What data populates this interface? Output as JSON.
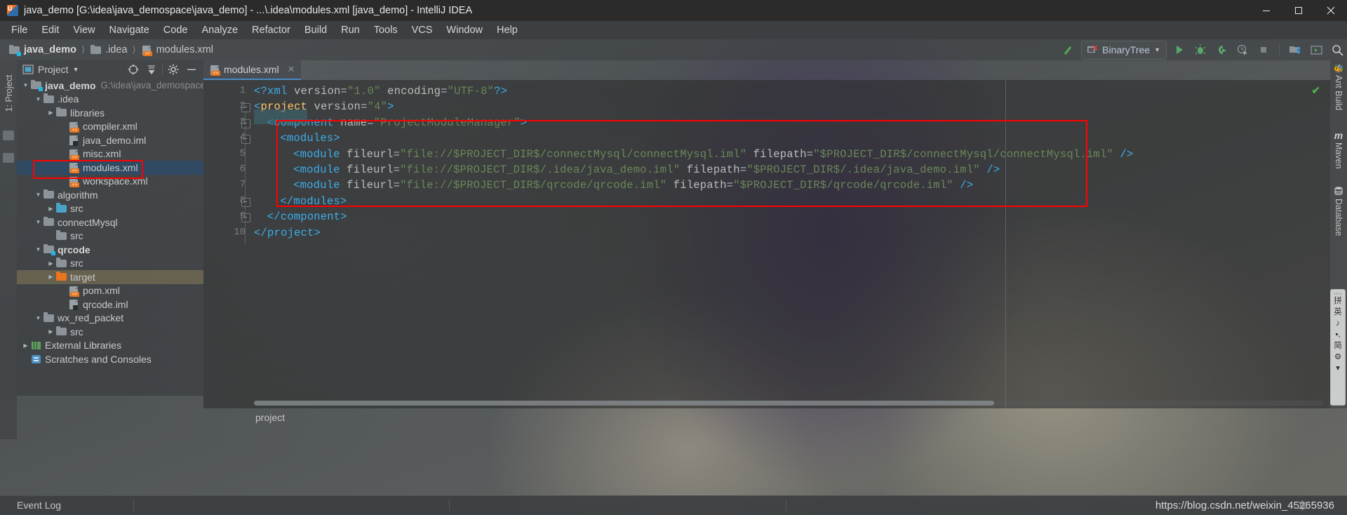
{
  "window": {
    "title": "java_demo [G:\\idea\\java_demospace\\java_demo] - ...\\.idea\\modules.xml [java_demo] - IntelliJ IDEA",
    "app_icon": "intellij-idea-icon",
    "controls": {
      "minimize": "minimize-icon",
      "maximize": "maximize-icon",
      "close": "close-icon"
    }
  },
  "menubar": {
    "items": [
      "File",
      "Edit",
      "View",
      "Navigate",
      "Code",
      "Analyze",
      "Refactor",
      "Build",
      "Run",
      "Tools",
      "VCS",
      "Window",
      "Help"
    ]
  },
  "navbar": {
    "breadcrumb": [
      "java_demo",
      ".idea",
      "modules.xml"
    ],
    "run_config": "BinaryTree",
    "buttons": [
      "run-icon",
      "debug-icon",
      "run-with-coverage-icon",
      "profiler-icon",
      "stop-icon",
      "project-structure-icon",
      "terminal-icon",
      "search-everywhere-icon"
    ],
    "build_icon": "make-project-icon"
  },
  "left_strip": {
    "label": "1: Project"
  },
  "right_strip": {
    "items": [
      "Ant Build",
      "Maven",
      "Database"
    ]
  },
  "project_tool_window": {
    "title": "Project",
    "header_buttons": [
      "scroll-from-source-icon",
      "collapse-all-icon",
      "settings-gear-icon",
      "hide-icon"
    ],
    "tree": [
      {
        "depth": 0,
        "arrow": "down",
        "icon": "module-folder-icon",
        "label": "java_demo",
        "bold": true,
        "path": "G:\\idea\\java_demospace\\j",
        "state": "normal"
      },
      {
        "depth": 1,
        "arrow": "down",
        "icon": "folder-icon",
        "label": ".idea",
        "bold": false,
        "path": "",
        "state": "normal"
      },
      {
        "depth": 2,
        "arrow": "right",
        "icon": "folder-icon",
        "label": "libraries",
        "bold": false,
        "path": "",
        "state": "normal"
      },
      {
        "depth": 3,
        "arrow": "none",
        "icon": "xml-file-icon",
        "label": "compiler.xml",
        "bold": false,
        "path": "",
        "state": "normal"
      },
      {
        "depth": 3,
        "arrow": "none",
        "icon": "iml-file-icon",
        "label": "java_demo.iml",
        "bold": false,
        "path": "",
        "state": "normal"
      },
      {
        "depth": 3,
        "arrow": "none",
        "icon": "xml-file-icon",
        "label": "misc.xml",
        "bold": false,
        "path": "",
        "state": "normal"
      },
      {
        "depth": 3,
        "arrow": "none",
        "icon": "xml-file-icon",
        "label": "modules.xml",
        "bold": false,
        "path": "",
        "state": "selected"
      },
      {
        "depth": 3,
        "arrow": "none",
        "icon": "xml-file-icon",
        "label": "workspace.xml",
        "bold": false,
        "path": "",
        "state": "normal"
      },
      {
        "depth": 1,
        "arrow": "down",
        "icon": "folder-icon",
        "label": "algorithm",
        "bold": false,
        "path": "",
        "state": "normal"
      },
      {
        "depth": 2,
        "arrow": "right",
        "icon": "source-folder-icon",
        "label": "src",
        "bold": false,
        "path": "",
        "state": "normal"
      },
      {
        "depth": 1,
        "arrow": "down",
        "icon": "folder-icon",
        "label": "connectMysql",
        "bold": false,
        "path": "",
        "state": "normal"
      },
      {
        "depth": 2,
        "arrow": "none",
        "icon": "folder-icon",
        "label": "src",
        "bold": false,
        "path": "",
        "state": "normal"
      },
      {
        "depth": 1,
        "arrow": "down",
        "icon": "module-folder-icon",
        "label": "qrcode",
        "bold": true,
        "path": "",
        "state": "normal"
      },
      {
        "depth": 2,
        "arrow": "right",
        "icon": "folder-icon",
        "label": "src",
        "bold": false,
        "path": "",
        "state": "normal"
      },
      {
        "depth": 2,
        "arrow": "right",
        "icon": "excluded-folder-icon",
        "label": "target",
        "bold": false,
        "path": "",
        "state": "highlighted"
      },
      {
        "depth": 3,
        "arrow": "none",
        "icon": "xml-file-icon",
        "label": "pom.xml",
        "bold": false,
        "path": "",
        "state": "normal"
      },
      {
        "depth": 3,
        "arrow": "none",
        "icon": "iml-file-icon",
        "label": "qrcode.iml",
        "bold": false,
        "path": "",
        "state": "normal"
      },
      {
        "depth": 1,
        "arrow": "down",
        "icon": "folder-icon",
        "label": "wx_red_packet",
        "bold": false,
        "path": "",
        "state": "normal"
      },
      {
        "depth": 2,
        "arrow": "right",
        "icon": "folder-icon",
        "label": "src",
        "bold": false,
        "path": "",
        "state": "normal"
      },
      {
        "depth": 0,
        "arrow": "right",
        "icon": "external-libraries-icon",
        "label": "External Libraries",
        "bold": false,
        "path": "",
        "state": "normal"
      },
      {
        "depth": 0,
        "arrow": "none",
        "icon": "scratches-icon",
        "label": "Scratches and Consoles",
        "bold": false,
        "path": "",
        "state": "normal"
      }
    ]
  },
  "editor": {
    "tab": {
      "label": "modules.xml",
      "icon": "xml-file-icon",
      "close": "close-tab-icon"
    },
    "line_numbers": [
      "1",
      "2",
      "3",
      "4",
      "5",
      "6",
      "7",
      "8",
      "9",
      "10"
    ],
    "inspection_status": "ok-check-icon",
    "breadcrumb": "project",
    "code": [
      {
        "n": 1,
        "indent": 0,
        "tokens": [
          {
            "t": "<?xml ",
            "c": "k-tag"
          },
          {
            "t": "version",
            "c": "k-attr"
          },
          {
            "t": "=",
            "c": "k-plain"
          },
          {
            "t": "\"1.0\"",
            "c": "k-str"
          },
          {
            "t": " encoding",
            "c": "k-attr"
          },
          {
            "t": "=",
            "c": "k-plain"
          },
          {
            "t": "\"UTF-8\"",
            "c": "k-str"
          },
          {
            "t": "?>",
            "c": "k-tag"
          }
        ]
      },
      {
        "n": 2,
        "indent": 0,
        "tokens": [
          {
            "t": "<",
            "c": "k-tag"
          },
          {
            "t": "project",
            "c": "k-name"
          },
          {
            "t": " version",
            "c": "k-attr"
          },
          {
            "t": "=",
            "c": "k-plain"
          },
          {
            "t": "\"4\"",
            "c": "k-str"
          },
          {
            "t": ">",
            "c": "k-tag"
          }
        ]
      },
      {
        "n": 3,
        "indent": 1,
        "tokens": [
          {
            "t": "<",
            "c": "k-tag"
          },
          {
            "t": "component",
            "c": "k-tag"
          },
          {
            "t": " name",
            "c": "k-attr"
          },
          {
            "t": "=",
            "c": "k-plain"
          },
          {
            "t": "\"ProjectModuleManager\"",
            "c": "k-str"
          },
          {
            "t": ">",
            "c": "k-tag"
          }
        ]
      },
      {
        "n": 4,
        "indent": 2,
        "tokens": [
          {
            "t": "<modules>",
            "c": "k-tag"
          }
        ]
      },
      {
        "n": 5,
        "indent": 3,
        "tokens": [
          {
            "t": "<module",
            "c": "k-tag"
          },
          {
            "t": " fileurl",
            "c": "k-attr"
          },
          {
            "t": "=",
            "c": "k-plain"
          },
          {
            "t": "\"file://$PROJECT_DIR$/connectMysql/connectMysql.iml\"",
            "c": "k-str"
          },
          {
            "t": " filepath",
            "c": "k-attr"
          },
          {
            "t": "=",
            "c": "k-plain"
          },
          {
            "t": "\"$PROJECT_DIR$/connectMysql/connectMysql.iml\"",
            "c": "k-str"
          },
          {
            "t": " />",
            "c": "k-tag"
          }
        ]
      },
      {
        "n": 6,
        "indent": 3,
        "tokens": [
          {
            "t": "<module",
            "c": "k-tag"
          },
          {
            "t": " fileurl",
            "c": "k-attr"
          },
          {
            "t": "=",
            "c": "k-plain"
          },
          {
            "t": "\"file://$PROJECT_DIR$/.idea/java_demo.iml\"",
            "c": "k-str"
          },
          {
            "t": " filepath",
            "c": "k-attr"
          },
          {
            "t": "=",
            "c": "k-plain"
          },
          {
            "t": "\"$PROJECT_DIR$/.idea/java_demo.iml\"",
            "c": "k-str"
          },
          {
            "t": " />",
            "c": "k-tag"
          }
        ]
      },
      {
        "n": 7,
        "indent": 3,
        "tokens": [
          {
            "t": "<module",
            "c": "k-tag"
          },
          {
            "t": " fileurl",
            "c": "k-attr"
          },
          {
            "t": "=",
            "c": "k-plain"
          },
          {
            "t": "\"file://$PROJECT_DIR$/qrcode/qrcode.iml\"",
            "c": "k-str"
          },
          {
            "t": " filepath",
            "c": "k-attr"
          },
          {
            "t": "=",
            "c": "k-plain"
          },
          {
            "t": "\"$PROJECT_DIR$/qrcode/qrcode.iml\"",
            "c": "k-str"
          },
          {
            "t": " />",
            "c": "k-tag"
          }
        ]
      },
      {
        "n": 8,
        "indent": 2,
        "tokens": [
          {
            "t": "</modules>",
            "c": "k-tag"
          }
        ]
      },
      {
        "n": 9,
        "indent": 1,
        "tokens": [
          {
            "t": "</component>",
            "c": "k-tag"
          }
        ]
      },
      {
        "n": 10,
        "indent": 0,
        "tokens": [
          {
            "t": "</project>",
            "c": "k-tag"
          }
        ]
      }
    ]
  },
  "statusbar": {
    "left": "Event Log",
    "watermark": "https://blog.csdn.net/weixin_45265936",
    "gear": "settings-gear-icon"
  },
  "ime": {
    "cells": [
      "拼",
      "英",
      "♪",
      "▪,",
      "简",
      "⚙"
    ]
  },
  "colors": {
    "accent": "#4a88c7",
    "selection": "#2f4a62",
    "annotation_red": "#ff0000",
    "string_green": "#6a8759",
    "tag_blue": "#3daee9",
    "name_yellow": "#ffc66d",
    "folder_orange": "#e8761f"
  }
}
